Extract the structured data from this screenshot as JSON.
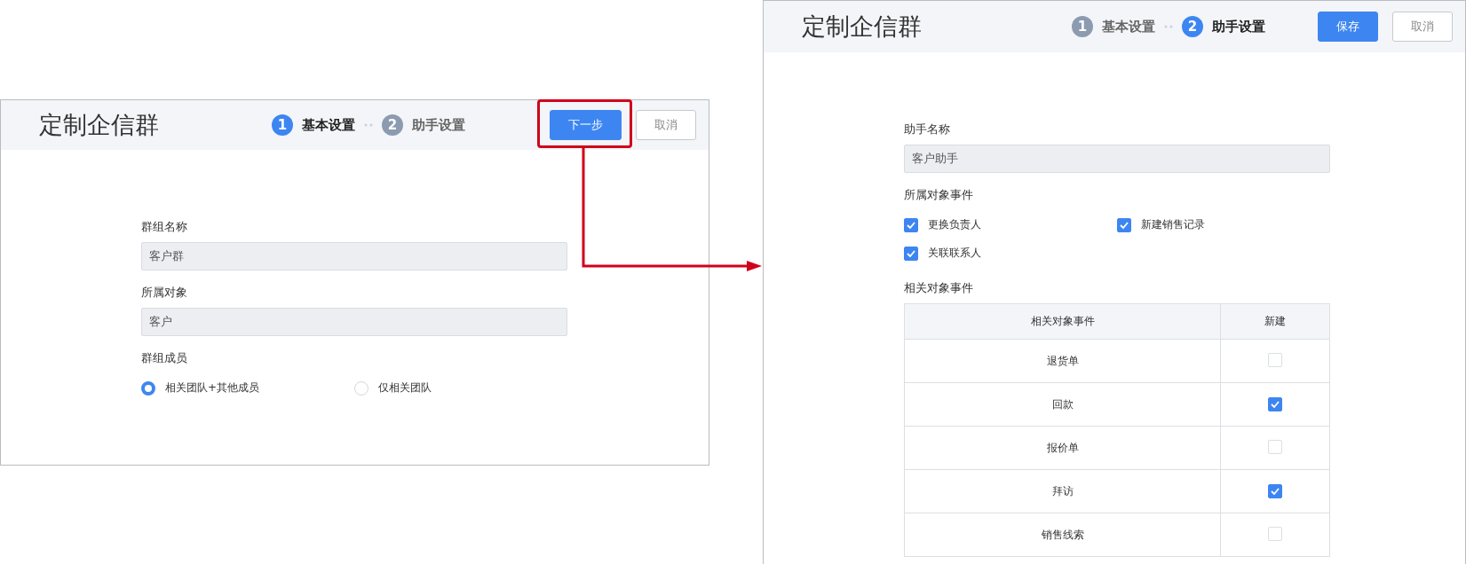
{
  "windows": [
    {
      "title": "定制企信群",
      "steps": [
        {
          "number": "1",
          "label": "基本设置",
          "selected": true
        },
        {
          "number": "2",
          "label": "助手设置",
          "selected": false
        }
      ],
      "buttons": [
        {
          "label": "下一步",
          "kind": "primary"
        },
        {
          "label": "取消",
          "kind": "default"
        }
      ],
      "fields": [
        {
          "label": "群组名称",
          "value": "客户群"
        },
        {
          "label": "所属对象",
          "value": "客户"
        }
      ],
      "members": {
        "label": "群组成员",
        "options": [
          {
            "label": "相关团队+其他成员",
            "selected": true
          },
          {
            "label": "仅相关团队",
            "selected": false
          }
        ]
      }
    },
    {
      "title": "定制企信群",
      "steps": [
        {
          "number": "1",
          "label": "基本设置",
          "selected": false
        },
        {
          "number": "2",
          "label": "助手设置",
          "selected": true
        }
      ],
      "buttons": [
        {
          "label": "保存",
          "kind": "primary"
        },
        {
          "label": "取消",
          "kind": "default"
        }
      ],
      "fields": [
        {
          "label": "助手名称",
          "value": "客户助手"
        }
      ],
      "object_events": {
        "label": "所属对象事件",
        "options": [
          {
            "label": "更换负责人",
            "checked": true
          },
          {
            "label": "新建销售记录",
            "checked": true
          },
          {
            "label": "关联联系人",
            "checked": true
          }
        ]
      },
      "related_events": {
        "label": "相关对象事件",
        "columns": [
          "相关对象事件",
          "新建"
        ],
        "rows": [
          {
            "name": "退货单",
            "checked": false
          },
          {
            "name": "回款",
            "checked": true
          },
          {
            "name": "报价单",
            "checked": false
          },
          {
            "name": "拜访",
            "checked": true
          },
          {
            "name": "销售线索",
            "checked": false
          }
        ]
      }
    }
  ]
}
